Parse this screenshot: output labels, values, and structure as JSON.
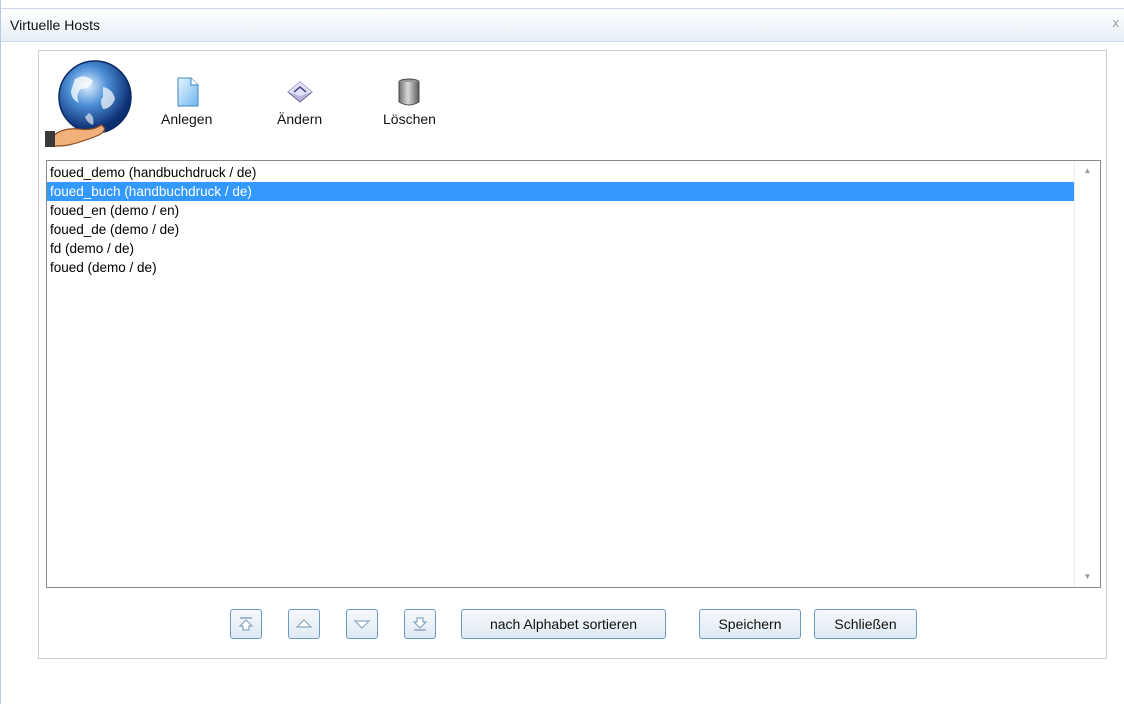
{
  "window": {
    "title": "Virtuelle Hosts",
    "close_glyph": "x"
  },
  "toolbar": {
    "logo_icon": "globe-in-hand-icon",
    "create": {
      "label": "Anlegen",
      "icon": "new-document-icon"
    },
    "edit": {
      "label": "Ändern",
      "icon": "edit-diamond-icon"
    },
    "delete": {
      "label": "Löschen",
      "icon": "trash-can-icon"
    }
  },
  "host_list": {
    "items": [
      {
        "label": "foued_demo (handbuchdruck / de)",
        "selected": false
      },
      {
        "label": "foued_buch (handbuchdruck / de)",
        "selected": true
      },
      {
        "label": "foued_en (demo / en)",
        "selected": false
      },
      {
        "label": "foued_de (demo / de)",
        "selected": false
      },
      {
        "label": "fd (demo / de)",
        "selected": false
      },
      {
        "label": "foued (demo / de)",
        "selected": false
      }
    ],
    "scroll_up_icon": "scroll-up-arrow-icon",
    "scroll_down_icon": "scroll-down-arrow-icon"
  },
  "buttons": {
    "move_top_icon": "move-to-top-icon",
    "move_up_icon": "move-up-icon",
    "move_down_icon": "move-down-icon",
    "move_bottom_icon": "move-to-bottom-icon",
    "sort_label": "nach Alphabet sortieren",
    "save_label": "Speichern",
    "close_label": "Schließen"
  },
  "colors": {
    "selection": "#3399ff",
    "button_border": "#6a9bc8"
  }
}
